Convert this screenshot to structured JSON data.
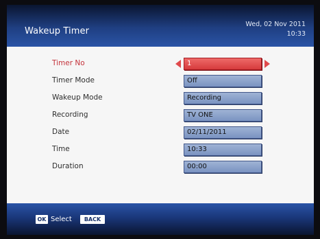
{
  "header": {
    "title": "Wakeup Timer",
    "date": "Wed, 02 Nov 2011",
    "time": "10:33"
  },
  "settings": [
    {
      "label": "Timer No",
      "value": "1",
      "selected": true
    },
    {
      "label": "Timer Mode",
      "value": "Off"
    },
    {
      "label": "Wakeup Mode",
      "value": "Recording"
    },
    {
      "label": "Recording",
      "value": "TV ONE"
    },
    {
      "label": "Date",
      "value": "02/11/2011"
    },
    {
      "label": "Time",
      "value": "10:33"
    },
    {
      "label": "Duration",
      "value": "00:00"
    }
  ],
  "footer": {
    "ok_key": "OK",
    "select_label": "Select",
    "back_key": "BACK"
  },
  "colors": {
    "header_blue": "#1f3f82",
    "field_blue": "#7a93c1",
    "active_red": "#d63a3d",
    "active_label": "#c4333b"
  }
}
